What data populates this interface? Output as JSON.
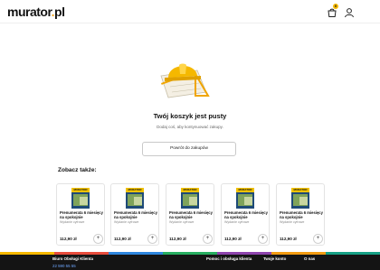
{
  "header": {
    "logo_main": "murator",
    "logo_dot": ".",
    "logo_tld": "pl",
    "cart_icon": "cart-icon",
    "cart_count": "0",
    "user_icon": "user-icon"
  },
  "empty_cart": {
    "illustration": "hard-hat-blueprint-illustration",
    "title": "Twój koszyk jest pusty",
    "subtitle": "Dodaj coś, aby kontynuować zakupy.",
    "back_button": "Powrót do zakupów"
  },
  "see_also": {
    "heading": "Zobacz także:",
    "products": [
      {
        "title": "Prenumerata 6 miesięcy na spokojnie",
        "subtitle": "Wydanie cyfrowe",
        "price": "112,90 zł",
        "add_label": "+"
      },
      {
        "title": "Prenumerata 6 miesięcy na spokojnie",
        "subtitle": "Wydanie cyfrowe",
        "price": "112,90 zł",
        "add_label": "+"
      },
      {
        "title": "Prenumerata 6 miesięcy na spokojnie",
        "subtitle": "Wydanie cyfrowe",
        "price": "112,90 zł",
        "add_label": "+"
      },
      {
        "title": "Prenumerata 6 miesięcy na spokojnie",
        "subtitle": "Wydanie cyfrowe",
        "price": "112,90 zł",
        "add_label": "+"
      },
      {
        "title": "Prenumerata 6 miesięcy na spokojnie",
        "subtitle": "Wydanie cyfrowe",
        "price": "112,90 zł",
        "add_label": "+"
      }
    ],
    "cover_label": "MURATOR"
  },
  "footer": {
    "customer_service": "Biuro Obsługi Klienta",
    "phone": "22 590 55 55",
    "help": "Pomoc i obsługa klienta",
    "account": "Twoje konto",
    "about": "O nas",
    "stripe_colors": [
      "#f5b800",
      "#e74c3c",
      "#2e86de",
      "#27ae60",
      "#8e44ad",
      "#f39c12",
      "#16a085"
    ]
  },
  "colors": {
    "accent": "#f5b800",
    "footer_bg": "#141414"
  }
}
